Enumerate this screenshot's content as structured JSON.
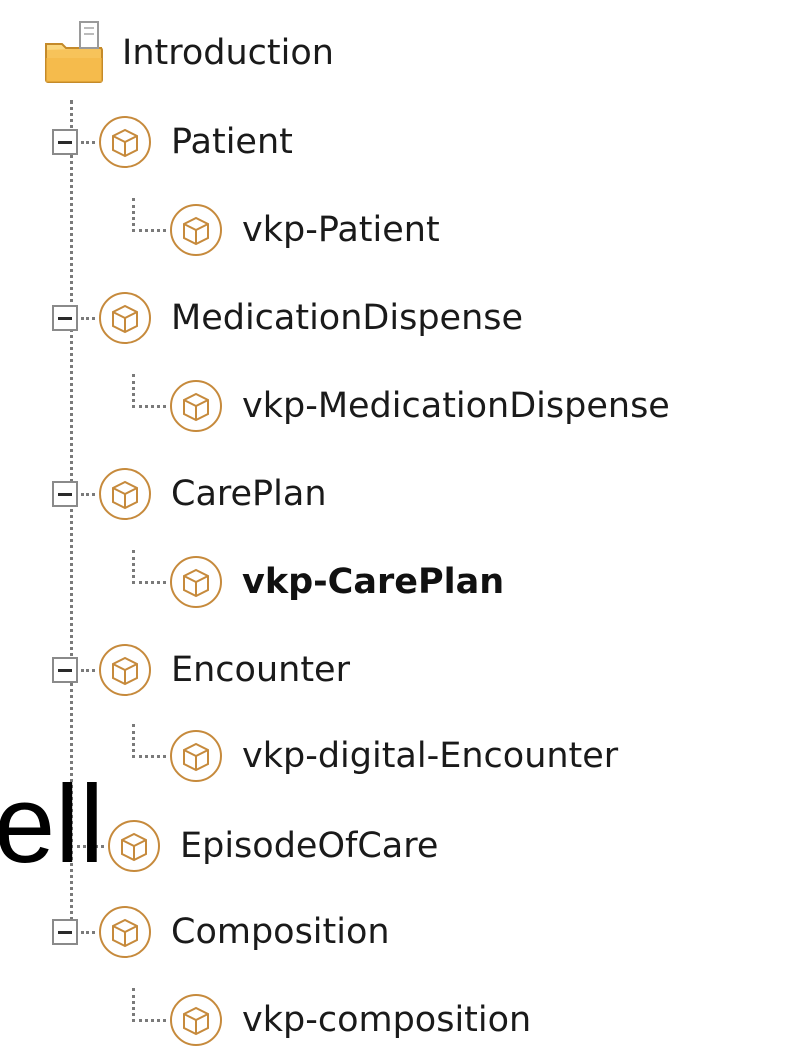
{
  "tree": {
    "root": {
      "label": "Introduction",
      "icon": "folder-icon"
    },
    "nodes": [
      {
        "label": "Patient",
        "expanded": true,
        "child": {
          "label": "vkp-Patient",
          "bold": false
        }
      },
      {
        "label": "MedicationDispense",
        "expanded": true,
        "child": {
          "label": "vkp-MedicationDispense",
          "bold": false
        }
      },
      {
        "label": "CarePlan",
        "expanded": true,
        "child": {
          "label": "vkp-CarePlan",
          "bold": true
        }
      },
      {
        "label": "Encounter",
        "expanded": true,
        "child": {
          "label": "vkp-digital-Encounter",
          "bold": false
        }
      },
      {
        "label": "EpisodeOfCare",
        "expanded": false
      },
      {
        "label": "Composition",
        "expanded": true,
        "child": {
          "label": "vkp-composition",
          "bold": false
        }
      }
    ]
  },
  "overlay": {
    "text": "ell"
  },
  "colors": {
    "cube": "#f3c27a",
    "folder": "#f7c35a",
    "text": "#1a1a1a"
  }
}
